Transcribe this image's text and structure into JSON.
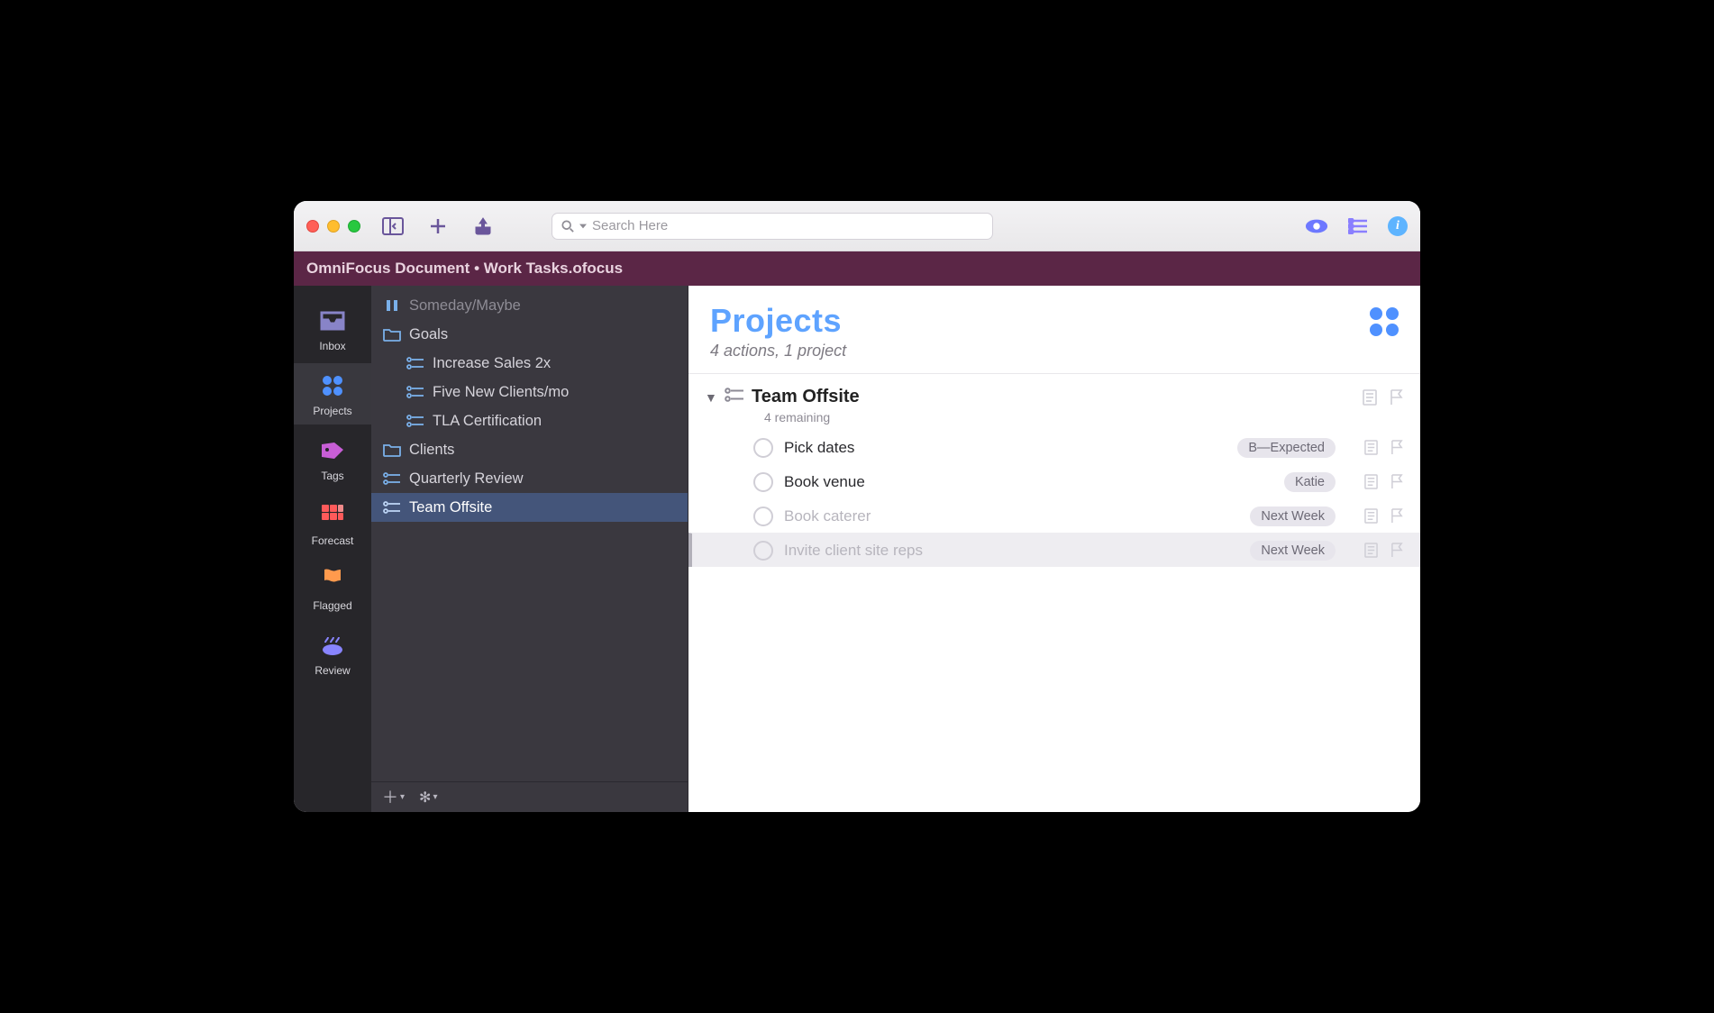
{
  "toolbar": {
    "search_placeholder": "Search Here"
  },
  "pathbar": "OmniFocus Document • Work Tasks.ofocus",
  "rail": {
    "items": [
      {
        "label": "Inbox"
      },
      {
        "label": "Projects"
      },
      {
        "label": "Tags"
      },
      {
        "label": "Forecast"
      },
      {
        "label": "Flagged"
      },
      {
        "label": "Review"
      }
    ]
  },
  "outline": {
    "items": [
      {
        "label": "Someday/Maybe",
        "type": "paused-folder",
        "muted": true,
        "level": 1
      },
      {
        "label": "Goals",
        "type": "folder",
        "level": 1
      },
      {
        "label": "Increase Sales 2x",
        "type": "project",
        "level": 2
      },
      {
        "label": "Five New Clients/mo",
        "type": "project",
        "level": 2
      },
      {
        "label": "TLA Certification",
        "type": "project",
        "level": 2
      },
      {
        "label": "Clients",
        "type": "folder",
        "level": 1
      },
      {
        "label": "Quarterly Review",
        "type": "project",
        "level": 1
      },
      {
        "label": "Team Offsite",
        "type": "project",
        "level": 1,
        "selected": true
      }
    ]
  },
  "main": {
    "title": "Projects",
    "subtitle": "4 actions, 1 project",
    "project": {
      "title": "Team Offsite",
      "remaining": "4 remaining"
    },
    "tasks": [
      {
        "title": "Pick dates",
        "badge": "B—Expected"
      },
      {
        "title": "Book venue",
        "badge": "Katie"
      },
      {
        "title": "Book caterer",
        "badge": "Next Week",
        "muted": true
      },
      {
        "title": "Invite client site reps",
        "badge": "Next Week",
        "muted": true,
        "selected": true
      }
    ]
  }
}
